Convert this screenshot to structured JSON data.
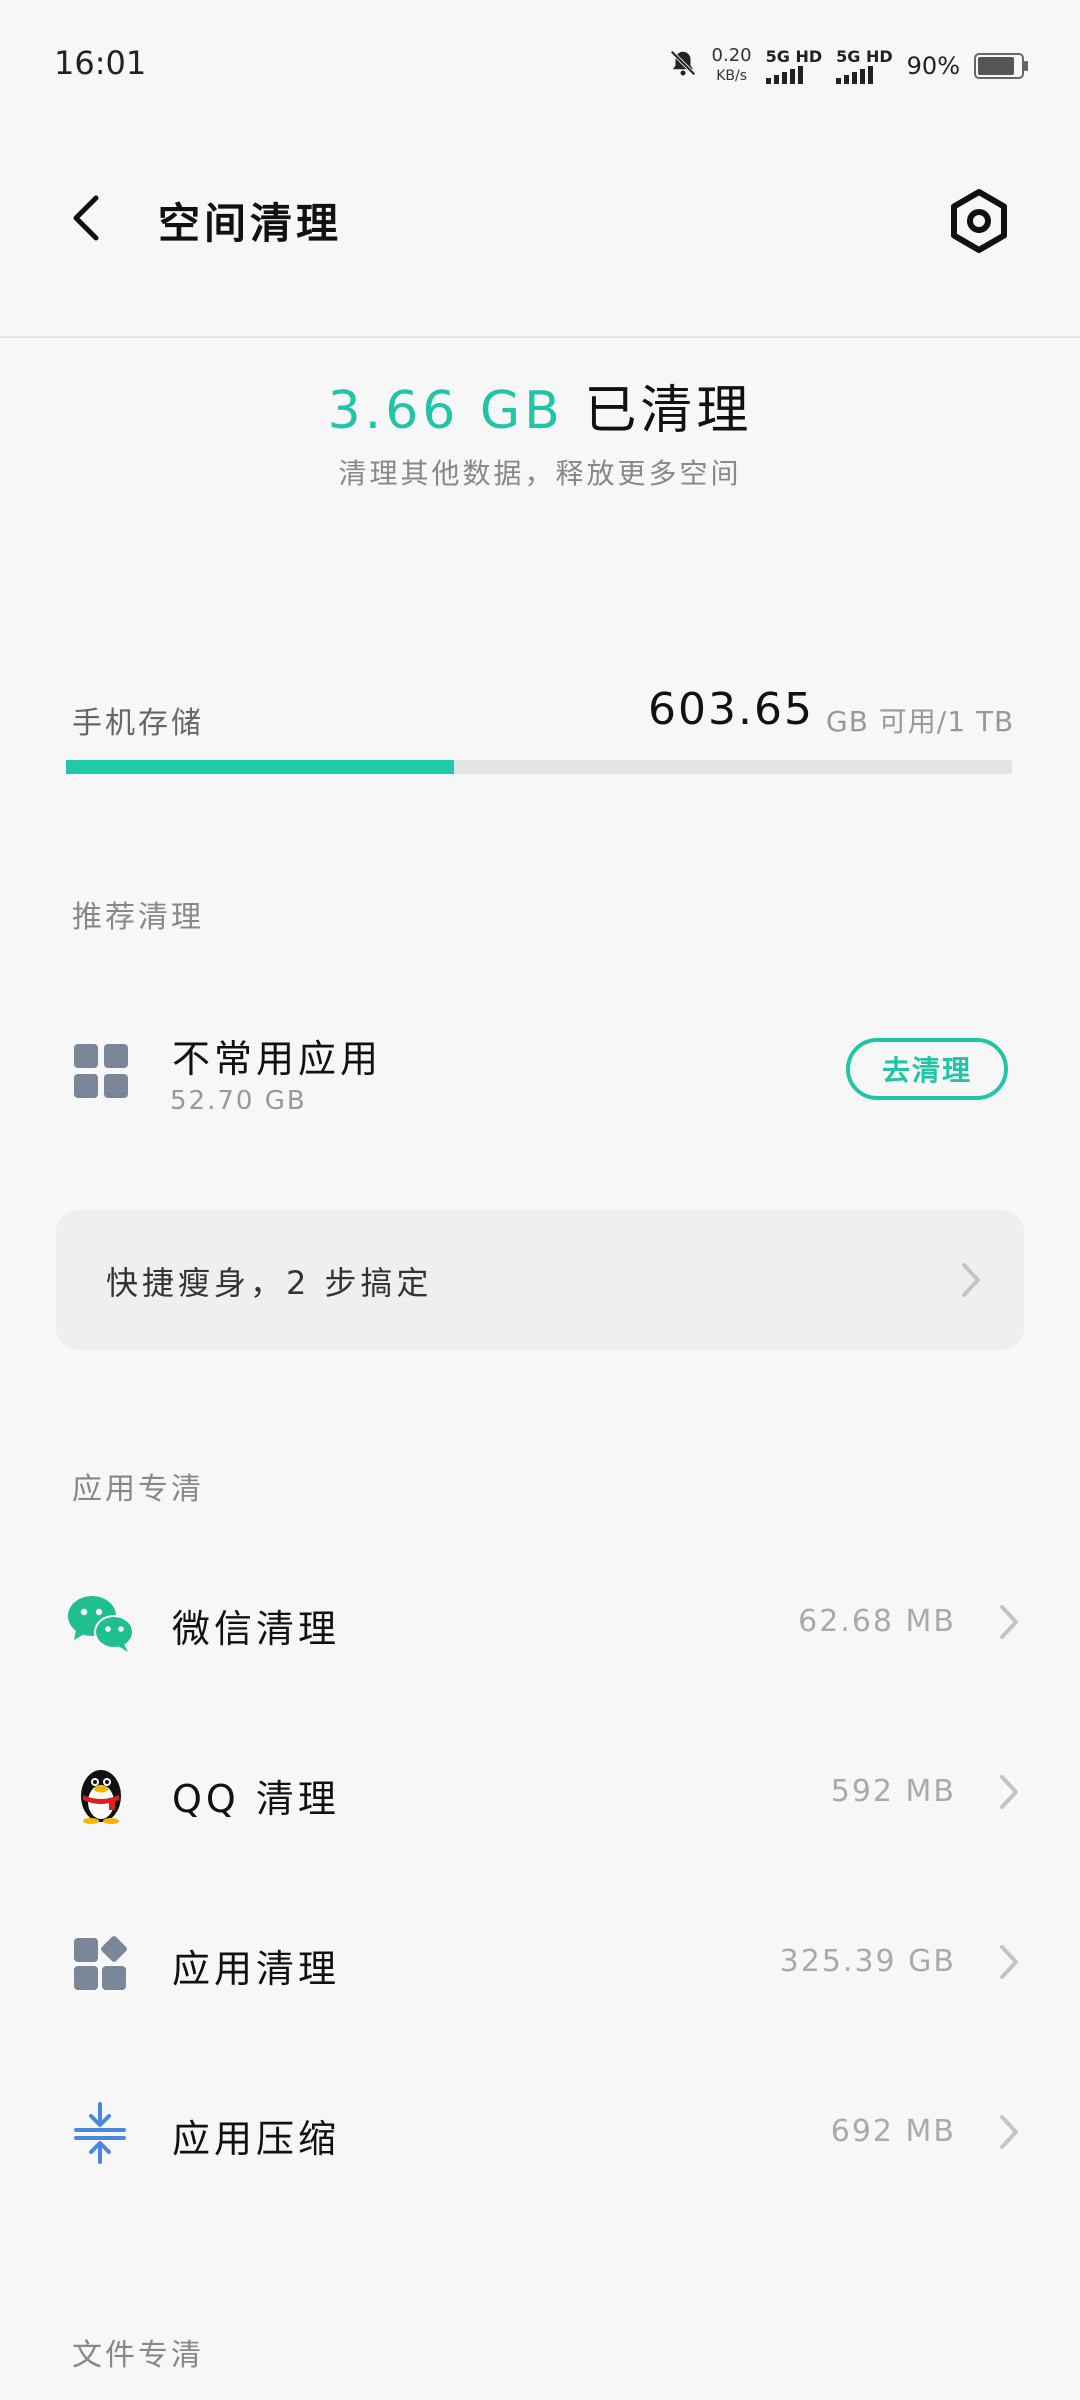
{
  "status_bar": {
    "time": "16:01",
    "net_speed": "0.20",
    "net_unit": "KB/s",
    "sim1": "5G HD",
    "sim2": "5G HD",
    "battery": "90%"
  },
  "header": {
    "title": "空间清理",
    "back_icon": "chevron-left-icon",
    "settings_icon": "gear-icon"
  },
  "summary": {
    "amount": "3.66 GB",
    "suffix": "已清理",
    "subtitle": "清理其他数据，释放更多空间"
  },
  "storage": {
    "label": "手机存储",
    "available": "603.65",
    "unit_text": "GB 可用/1 TB",
    "used_fraction": 0.41,
    "accent_color": "#20c9a7"
  },
  "recommended": {
    "title": "推荐清理",
    "item": {
      "name": "不常用应用",
      "size": "52.70 GB",
      "button": "去清理",
      "icon": "app-grid-icon"
    },
    "quick_card": "快捷瘦身，2 步搞定"
  },
  "app_section": {
    "title": "应用专清",
    "items": [
      {
        "label": "微信清理",
        "size": "62.68 MB",
        "icon": "wechat-icon"
      },
      {
        "label": "QQ 清理",
        "size": "592 MB",
        "icon": "qq-penguin-icon"
      },
      {
        "label": "应用清理",
        "size": "325.39 GB",
        "icon": "apps-icon"
      },
      {
        "label": "应用压缩",
        "size": "692 MB",
        "icon": "compress-icon"
      }
    ]
  },
  "file_section": {
    "title": "文件专清"
  },
  "colors": {
    "accent": "#20c4a6",
    "icon_gray": "#7a8799",
    "compress_blue": "#4a88e0"
  }
}
